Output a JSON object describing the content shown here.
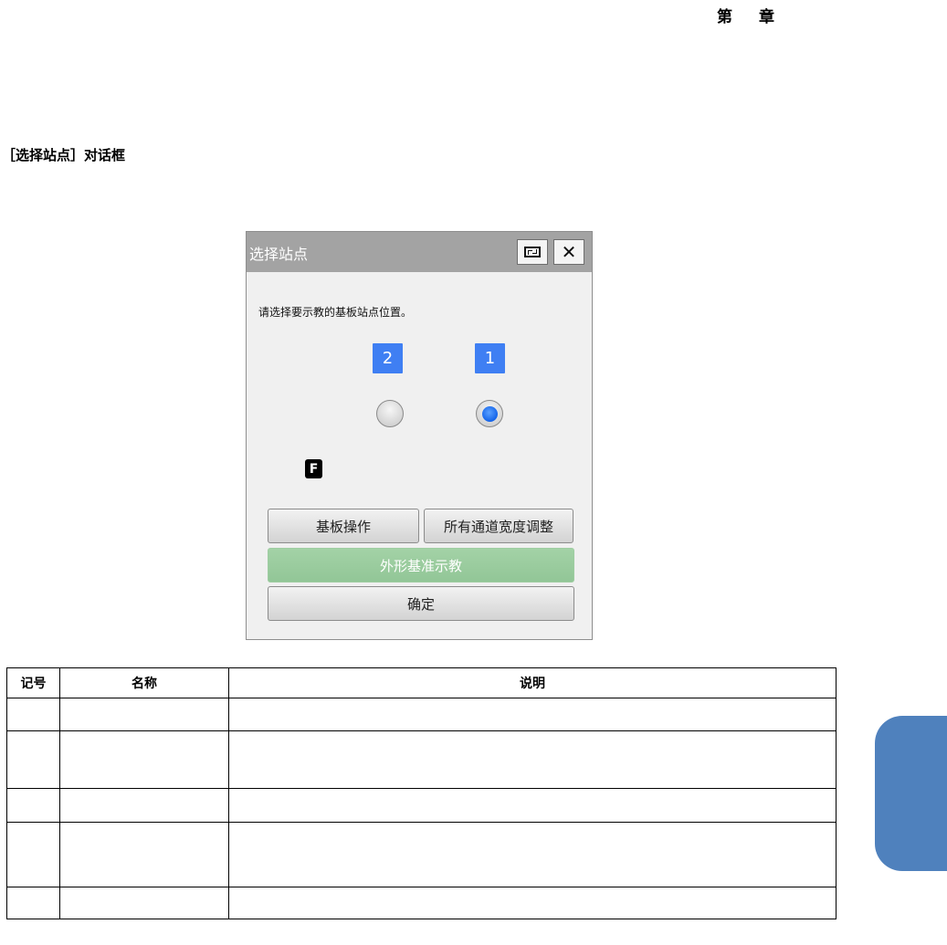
{
  "header": {
    "chapter_left": "第",
    "chapter_right": "章"
  },
  "section_title": "［选择站点］对话框",
  "dialog": {
    "title": "选择站点",
    "instruction": "请选择要示教的基板站点位置。",
    "stations": [
      {
        "label": "2",
        "selected": false
      },
      {
        "label": "1",
        "selected": true
      }
    ],
    "f_badge": "F",
    "buttons": {
      "board_operation": "基板操作",
      "all_lane_width": "所有通道宽度调整",
      "outline_reference": "外形基准示教",
      "ok": "确定"
    },
    "colors": {
      "station_badge": "#3f7ff3",
      "reference_button": "#97c99b",
      "titlebar": "#a3a3a3"
    }
  },
  "table": {
    "headers": [
      "记号",
      "名称",
      "说明"
    ],
    "rows": [
      [
        "",
        "",
        ""
      ],
      [
        "",
        "",
        ""
      ],
      [
        "",
        "",
        ""
      ],
      [
        "",
        "",
        ""
      ],
      [
        "",
        "",
        ""
      ]
    ]
  },
  "side_tab_color": "#4f81bd"
}
